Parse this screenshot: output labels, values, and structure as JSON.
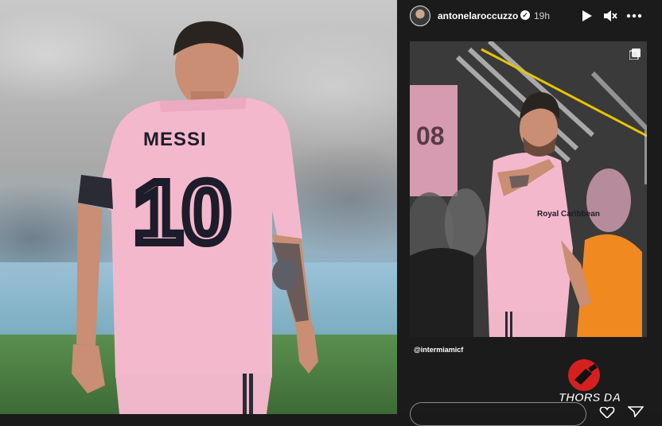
{
  "story": {
    "username": "antonelaroccuzzo",
    "verified_mark": "✓",
    "time": "19h",
    "tag": "@intermiamicf"
  },
  "left_photo": {
    "jersey_name": "MESSI",
    "jersey_number": "10"
  },
  "story_photo": {
    "sponsor_text": "Royal Caribbean",
    "backdrop_number": "08"
  },
  "watermark": {
    "text": "THORS DAY"
  },
  "icons": {
    "play": "play-icon",
    "mute": "mute-icon",
    "more": "more-icon",
    "multi": "multi-image-icon",
    "heart": "heart-icon",
    "send": "send-icon"
  },
  "colors": {
    "jersey_pink": "#f4b8cc",
    "jersey_text": "#1c1c2a",
    "story_bg": "#1b1b1b",
    "watermark_red": "#d62020"
  }
}
